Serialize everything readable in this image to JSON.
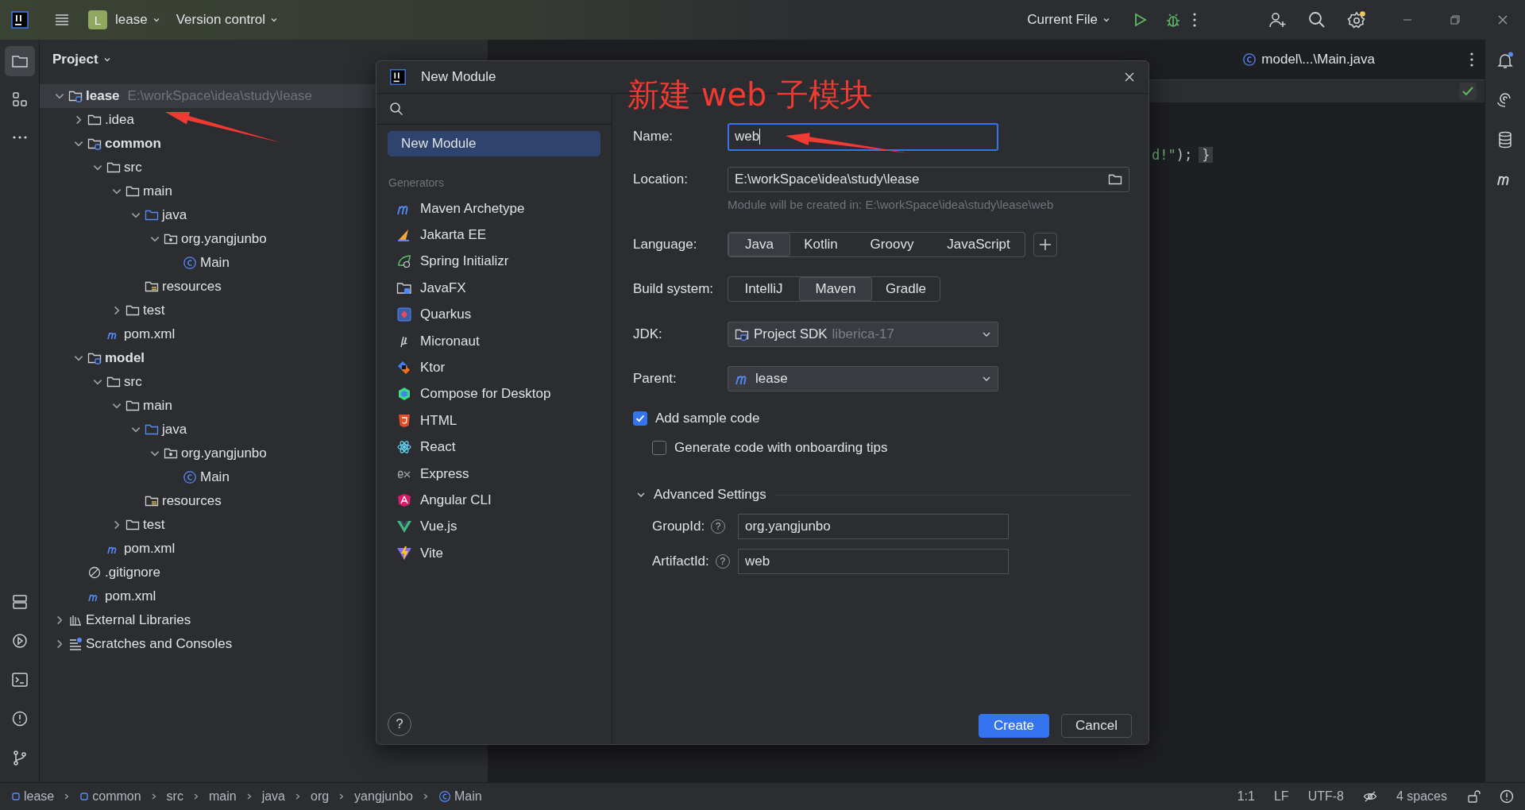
{
  "title_bar": {
    "project": {
      "badge": "L",
      "name": "lease"
    },
    "vcs": "Version control",
    "run_config": "Current File"
  },
  "left_toolbar": [
    {
      "kind": "project",
      "selected": true
    },
    {
      "kind": "structure",
      "selected": false
    },
    {
      "kind": "more",
      "selected": false
    }
  ],
  "project_panel": {
    "title": "Project",
    "tree": [
      {
        "label": "lease",
        "path": "E:\\workSpace\\idea\\study\\lease",
        "kind": "module",
        "selected": true,
        "expanded": true,
        "children": [
          {
            "label": ".idea",
            "kind": "folder",
            "selected": false,
            "expanded": false
          },
          {
            "label": "common",
            "kind": "module",
            "selected": false,
            "expanded": true,
            "children": [
              {
                "label": "src",
                "kind": "folder",
                "selected": false,
                "expanded": true,
                "children": [
                  {
                    "label": "main",
                    "kind": "folder",
                    "selected": false,
                    "expanded": true,
                    "children": [
                      {
                        "label": "java",
                        "kind": "source",
                        "selected": false,
                        "expanded": true,
                        "children": [
                          {
                            "label": "org.yangjunbo",
                            "kind": "package",
                            "selected": false,
                            "expanded": true,
                            "children": [
                              {
                                "label": "Main",
                                "kind": "class",
                                "selected": false
                              }
                            ]
                          }
                        ]
                      },
                      {
                        "label": "resources",
                        "kind": "resources",
                        "selected": false
                      }
                    ]
                  },
                  {
                    "label": "test",
                    "kind": "folder",
                    "selected": false,
                    "expanded": false
                  }
                ]
              },
              {
                "label": "pom.xml",
                "kind": "maven",
                "selected": false
              }
            ]
          },
          {
            "label": "model",
            "kind": "module",
            "selected": false,
            "expanded": true,
            "children": [
              {
                "label": "src",
                "kind": "folder",
                "selected": false,
                "expanded": true,
                "children": [
                  {
                    "label": "main",
                    "kind": "folder",
                    "selected": false,
                    "expanded": true,
                    "children": [
                      {
                        "label": "java",
                        "kind": "source",
                        "selected": false,
                        "expanded": true,
                        "children": [
                          {
                            "label": "org.yangjunbo",
                            "kind": "package",
                            "selected": false,
                            "expanded": true,
                            "children": [
                              {
                                "label": "Main",
                                "kind": "class",
                                "selected": false
                              }
                            ]
                          }
                        ]
                      },
                      {
                        "label": "resources",
                        "kind": "resources",
                        "selected": false
                      }
                    ]
                  },
                  {
                    "label": "test",
                    "kind": "folder",
                    "selected": false,
                    "expanded": false
                  }
                ]
              },
              {
                "label": "pom.xml",
                "kind": "maven",
                "selected": false
              }
            ]
          },
          {
            "label": ".gitignore",
            "kind": "ignore",
            "selected": false
          },
          {
            "label": "pom.xml",
            "kind": "maven",
            "selected": false
          }
        ]
      },
      {
        "label": "External Libraries",
        "kind": "libraries",
        "selected": false,
        "expanded": false
      },
      {
        "label": "Scratches and Consoles",
        "kind": "scratches",
        "selected": false,
        "expanded": false
      }
    ]
  },
  "editor": {
    "tabs": [
      {
        "label": "model\\...\\Main.java"
      }
    ],
    "code": [
      {
        "text": "d!\"",
        "kind": "string"
      },
      {
        "text": ");",
        "kind": "plain"
      },
      {
        "text": "}",
        "kind": "brace"
      }
    ]
  },
  "dialog": {
    "title": "New Module",
    "sidebar": {
      "items": [
        {
          "label": "New Module",
          "selected": true
        }
      ],
      "section": "Generators",
      "generators": [
        {
          "label": "Maven Archetype",
          "kind": "maven"
        },
        {
          "label": "Jakarta EE",
          "kind": "jakarta"
        },
        {
          "label": "Spring Initializr",
          "kind": "spring"
        },
        {
          "label": "JavaFX",
          "kind": "javafx"
        },
        {
          "label": "Quarkus",
          "kind": "quarkus"
        },
        {
          "label": "Micronaut",
          "kind": "micronaut"
        },
        {
          "label": "Ktor",
          "kind": "ktor"
        },
        {
          "label": "Compose for Desktop",
          "kind": "compose"
        },
        {
          "label": "HTML",
          "kind": "html"
        },
        {
          "label": "React",
          "kind": "react"
        },
        {
          "label": "Express",
          "kind": "express"
        },
        {
          "label": "Angular CLI",
          "kind": "angular"
        },
        {
          "label": "Vue.js",
          "kind": "vue"
        },
        {
          "label": "Vite",
          "kind": "vite"
        }
      ],
      "help": "?"
    },
    "form": {
      "name": {
        "label": "Name:",
        "value": "web",
        "focused": true
      },
      "location": {
        "label": "Location:",
        "value": "E:\\workSpace\\idea\\study\\lease",
        "hint": "Module will be created in: E:\\workSpace\\idea\\study\\lease\\web"
      },
      "language": {
        "label": "Language:",
        "options": [
          {
            "label": "Java",
            "selected": true
          },
          {
            "label": "Kotlin",
            "selected": false
          },
          {
            "label": "Groovy",
            "selected": false
          },
          {
            "label": "JavaScript",
            "selected": false
          }
        ]
      },
      "build_system": {
        "label": "Build system:",
        "options": [
          {
            "label": "IntelliJ",
            "selected": false
          },
          {
            "label": "Maven",
            "selected": true
          },
          {
            "label": "Gradle",
            "selected": false
          }
        ]
      },
      "jdk": {
        "label": "JDK:",
        "value": "Project SDK",
        "detail": "liberica-17"
      },
      "parent": {
        "label": "Parent:",
        "value": "lease"
      },
      "checkboxes": [
        {
          "label": "Add sample code",
          "checked": true,
          "children": [
            {
              "label": "Generate code with onboarding tips",
              "checked": false
            }
          ]
        }
      ],
      "advanced": {
        "label": "Advanced Settings",
        "expanded": true,
        "fields": [
          {
            "label": "GroupId:",
            "help": "?",
            "value": "org.yangjunbo"
          },
          {
            "label": "ArtifactId:",
            "help": "?",
            "value": "web"
          }
        ]
      }
    },
    "buttons": [
      {
        "label": "Create",
        "kind": "primary"
      },
      {
        "label": "Cancel",
        "kind": "secondary"
      }
    ]
  },
  "annotation": {
    "text": "新建 web 子模块"
  },
  "status_bar": {
    "breadcrumbs": [
      {
        "label": "lease",
        "kind": "module"
      },
      {
        "label": "common",
        "kind": "module"
      },
      {
        "label": "src",
        "kind": "plain"
      },
      {
        "label": "main",
        "kind": "plain"
      },
      {
        "label": "java",
        "kind": "plain"
      },
      {
        "label": "org",
        "kind": "plain"
      },
      {
        "label": "yangjunbo",
        "kind": "plain"
      },
      {
        "label": "Main",
        "kind": "class"
      }
    ],
    "position": "1:1",
    "line_separator": "LF",
    "encoding": "UTF-8",
    "indent": "4 spaces"
  }
}
